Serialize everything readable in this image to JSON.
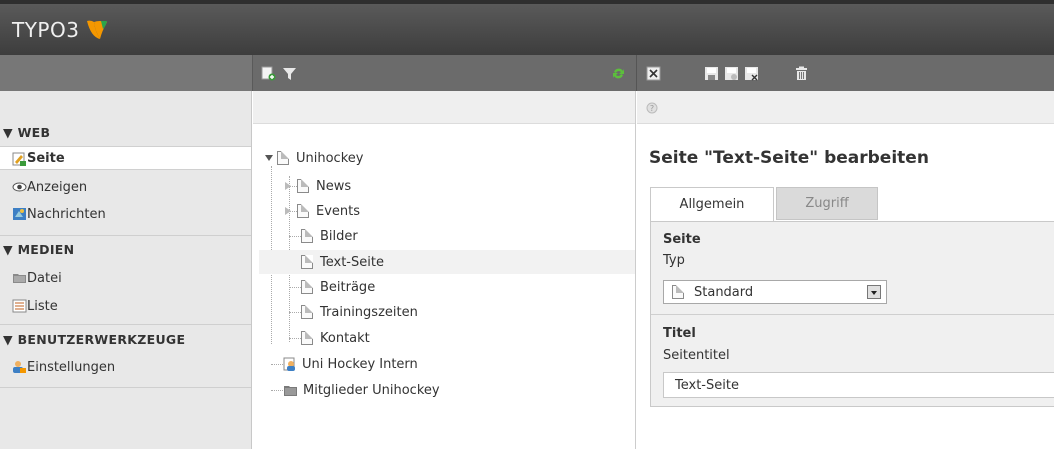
{
  "app": {
    "logo_text": "TYPO3"
  },
  "module_menu": {
    "groups": [
      {
        "label": "▼ WEB",
        "items": [
          {
            "label": "Seite",
            "icon": "page-module-icon",
            "active": true
          },
          {
            "label": "Anzeigen",
            "icon": "eye-icon"
          },
          {
            "label": "Nachrichten",
            "icon": "messages-icon"
          }
        ]
      },
      {
        "label": "▼ MEDIEN",
        "items": [
          {
            "label": "Datei",
            "icon": "folder-icon"
          },
          {
            "label": "Liste",
            "icon": "list-icon"
          }
        ]
      },
      {
        "label": "▼ BENUTZERWERKZEUGE",
        "items": [
          {
            "label": "Einstellungen",
            "icon": "user-settings-icon"
          }
        ]
      }
    ]
  },
  "tree": {
    "nodes": [
      {
        "label": "Unihockey"
      },
      {
        "label": "News"
      },
      {
        "label": "Events"
      },
      {
        "label": "Bilder"
      },
      {
        "label": "Text-Seite",
        "selected": true
      },
      {
        "label": "Beiträge"
      },
      {
        "label": "Trainingszeiten"
      },
      {
        "label": "Kontakt"
      },
      {
        "label": "Uni Hockey Intern"
      },
      {
        "label": "Mitglieder Unihockey"
      }
    ]
  },
  "edit": {
    "title": "Seite \"Text-Seite\" bearbeiten",
    "tabs": [
      "Allgemein",
      "Zugriff"
    ],
    "section1": {
      "heading": "Seite",
      "field_label": "Typ",
      "select_value": "Standard"
    },
    "section2": {
      "heading": "Titel",
      "field_label": "Seitentitel",
      "input_value": "Text-Seite"
    }
  },
  "colors": {
    "topbar": "#444444",
    "accent_orange": "#f49700",
    "accent_green": "#2aa44a"
  }
}
